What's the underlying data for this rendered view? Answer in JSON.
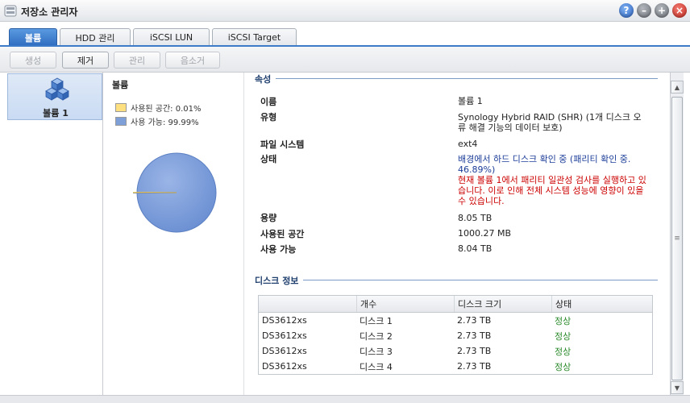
{
  "window": {
    "title": "저장소 관리자",
    "help_glyph": "?",
    "min_glyph": "–",
    "max_glyph": "+",
    "close_glyph": "×"
  },
  "tabs": [
    {
      "label": "볼륨",
      "active": true
    },
    {
      "label": "HDD 관리"
    },
    {
      "label": "iSCSI LUN"
    },
    {
      "label": "iSCSI Target"
    }
  ],
  "toolbar": {
    "create": "생성",
    "delete": "제거",
    "manage": "관리",
    "remove": "음소거"
  },
  "volumes": [
    {
      "label": "볼륨 1"
    }
  ],
  "usage": {
    "title": "볼륨",
    "used_label": "사용된 공간: 0.01%",
    "free_label": "사용 가능: 99.99%",
    "used_color": "#ffe080",
    "free_color": "#7f9fd8",
    "used_fraction": 0.0001
  },
  "properties": {
    "section_title": "속성",
    "name_label": "이름",
    "name_value": "볼륨 1",
    "type_label": "유형",
    "type_value": "Synology Hybrid RAID (SHR) (1개 디스크 오류 해결 기능의 데이터 보호)",
    "fs_label": "파일 시스템",
    "fs_value": "ext4",
    "status_label": "상태",
    "status_value_blue": "배경에서 하드 디스크 확인 중 (패리티 확인 중. 46.89%)",
    "status_value_red": "현재 볼륨 1에서 패리티 일관성 검사를 실행하고 있습니다. 이로 인해 전체 시스템 성능에 영향이 있을 수 있습니다.",
    "capacity_label": "용량",
    "capacity_value": "8.05 TB",
    "used_space_label": "사용된 공간",
    "used_space_value": "1000.27 MB",
    "available_label": "사용 가능",
    "available_value": "8.04 TB"
  },
  "disk_info": {
    "section_title": "디스크 정보",
    "columns": [
      "",
      "개수",
      "디스크 크기",
      "상태"
    ],
    "rows": [
      [
        "DS3612xs",
        "디스크 1",
        "2.73 TB",
        "정상"
      ],
      [
        "DS3612xs",
        "디스크 2",
        "2.73 TB",
        "정상"
      ],
      [
        "DS3612xs",
        "디스크 3",
        "2.73 TB",
        "정상"
      ],
      [
        "DS3612xs",
        "디스크 4",
        "2.73 TB",
        "정상"
      ]
    ]
  },
  "scrollbar": {
    "up": "▲",
    "down": "▼",
    "grip": "≡"
  }
}
